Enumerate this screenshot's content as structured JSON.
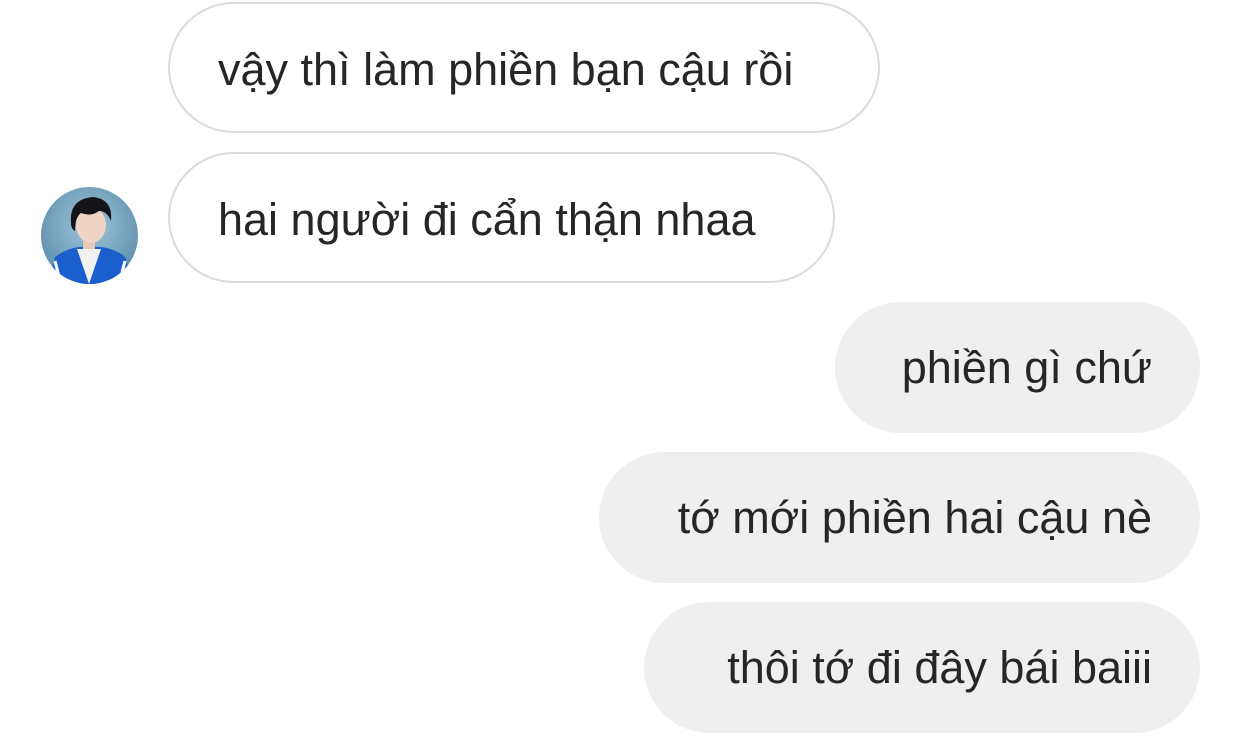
{
  "conversation": {
    "messages": [
      {
        "sender": "other",
        "text": "vậy thì làm phiền bạn cậu rồi"
      },
      {
        "sender": "other",
        "text": "hai người đi cẩn thận nhaa",
        "show_avatar": true
      },
      {
        "sender": "me",
        "text": "phiền gì chứ"
      },
      {
        "sender": "me",
        "text": "tớ mới phiền hai cậu nè"
      },
      {
        "sender": "me",
        "text": "thôi tớ đi đây bái baiii"
      }
    ]
  },
  "colors": {
    "incoming_bubble_bg": "#ffffff",
    "incoming_bubble_border": "#dbdbdb",
    "outgoing_bubble_bg": "#efefef",
    "text": "#262626"
  },
  "icons": {
    "avatar": "profile-photo"
  }
}
